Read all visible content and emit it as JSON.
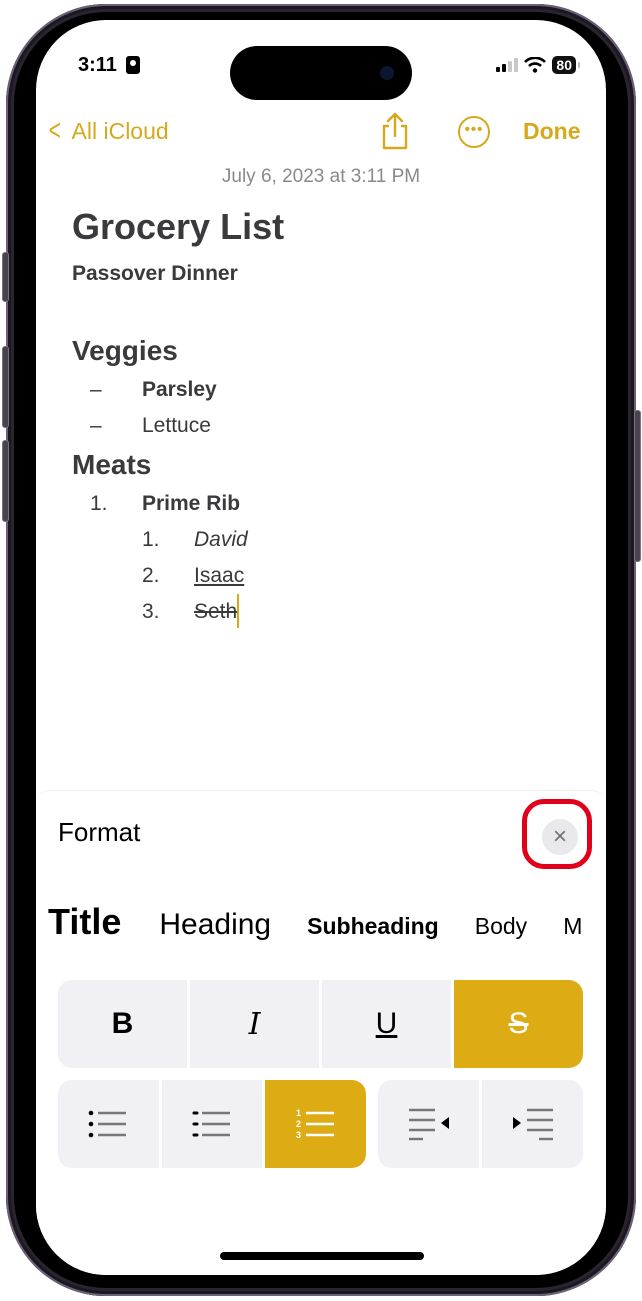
{
  "status_bar": {
    "time": "3:11",
    "battery": "80"
  },
  "nav": {
    "back_label": "All iCloud",
    "done_label": "Done",
    "accent": "#d6a91c"
  },
  "note": {
    "date": "July 6, 2023 at 3:11 PM",
    "title": "Grocery List",
    "subtitle": "Passover Dinner",
    "sections": [
      {
        "heading": "Veggies",
        "items": [
          {
            "marker": "–",
            "text": "Parsley",
            "style": "bold"
          },
          {
            "marker": "–",
            "text": "Lettuce",
            "style": "plain"
          }
        ]
      },
      {
        "heading": "Meats",
        "items": [
          {
            "marker": "1.",
            "text": "Prime Rib",
            "style": "bold"
          },
          {
            "marker": "1.",
            "text": "David",
            "style": "italic"
          },
          {
            "marker": "2.",
            "text": "Isaac",
            "style": "underline"
          },
          {
            "marker": "3.",
            "text": "Seth",
            "style": "strikethrough"
          }
        ]
      }
    ]
  },
  "format_panel": {
    "title": "Format",
    "close_label": "×",
    "styles": [
      "Title",
      "Heading",
      "Subheading",
      "Body",
      "M"
    ],
    "text_buttons": [
      {
        "label": "B",
        "active": false
      },
      {
        "label": "I",
        "active": false
      },
      {
        "label": "U",
        "active": false
      },
      {
        "label": "S",
        "active": true
      }
    ],
    "list_buttons": [
      {
        "name": "bulleted-list",
        "active": false
      },
      {
        "name": "dashed-list",
        "active": false
      },
      {
        "name": "numbered-list",
        "active": true
      }
    ],
    "indent_buttons": [
      {
        "name": "decrease-indent"
      },
      {
        "name": "increase-indent"
      }
    ],
    "active_color": "#ddab14",
    "highlight_color": "#e0001b"
  }
}
